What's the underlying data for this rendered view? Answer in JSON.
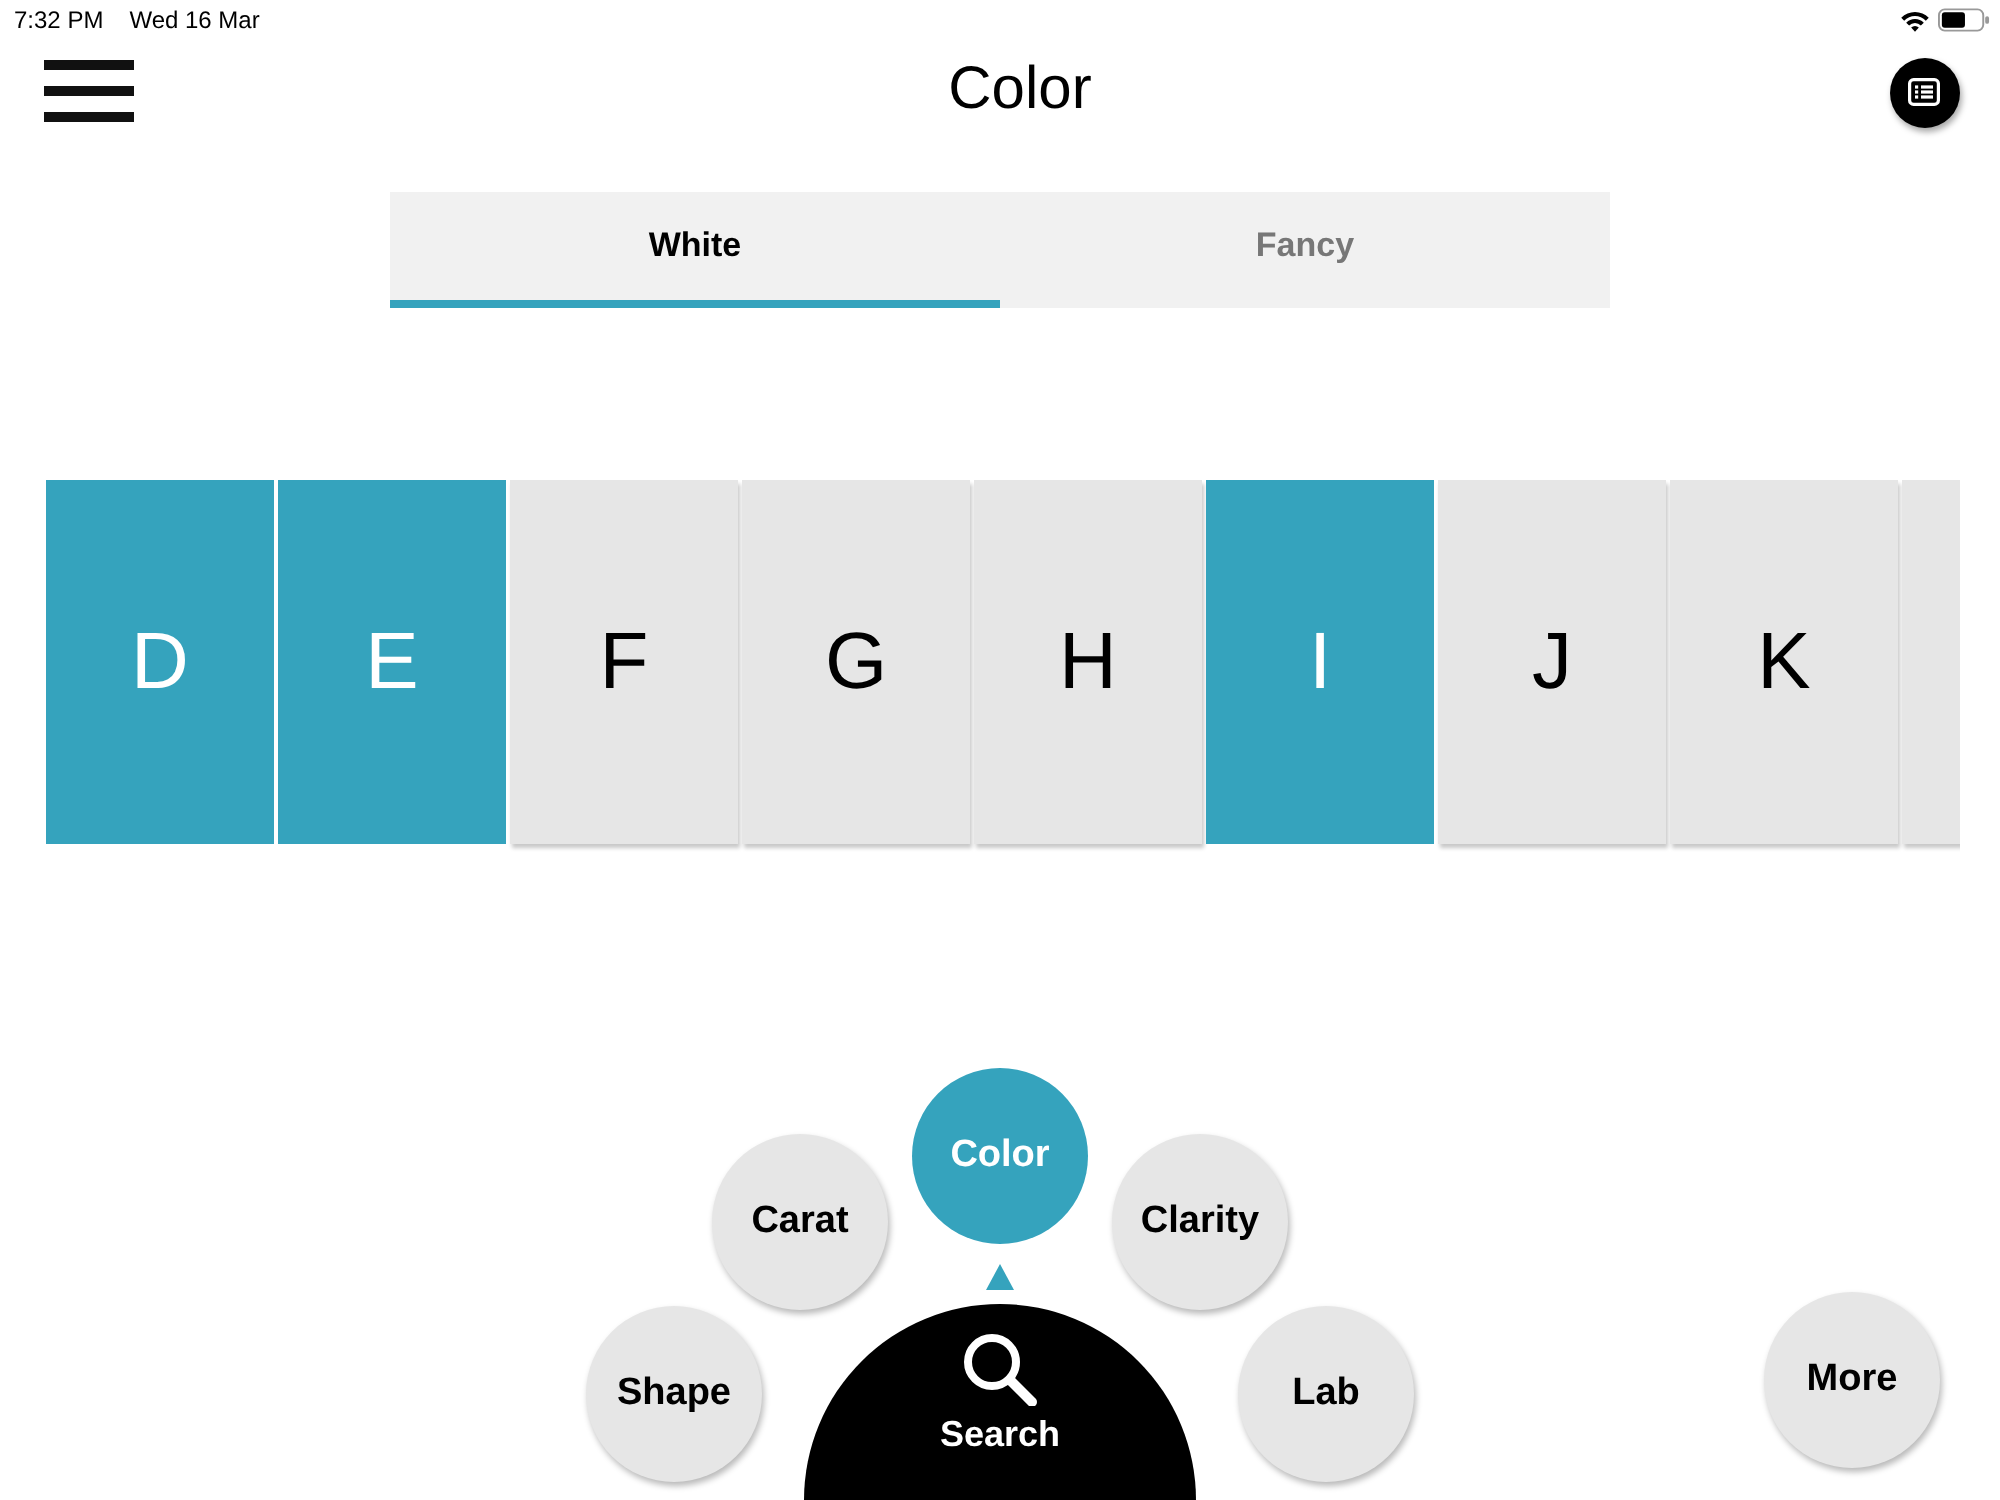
{
  "status_bar": {
    "time": "7:32 PM",
    "date": "Wed 16 Mar"
  },
  "header": {
    "title": "Color"
  },
  "tabs": [
    {
      "label": "White",
      "selected": true
    },
    {
      "label": "Fancy",
      "selected": false
    }
  ],
  "color_grades": [
    {
      "label": "D",
      "selected": true
    },
    {
      "label": "E",
      "selected": true
    },
    {
      "label": "F",
      "selected": false
    },
    {
      "label": "G",
      "selected": false
    },
    {
      "label": "H",
      "selected": false
    },
    {
      "label": "I",
      "selected": true
    },
    {
      "label": "J",
      "selected": false
    },
    {
      "label": "K",
      "selected": false
    }
  ],
  "search_menu": {
    "items": [
      {
        "label": "Shape",
        "selected": false
      },
      {
        "label": "Carat",
        "selected": false
      },
      {
        "label": "Color",
        "selected": true
      },
      {
        "label": "Clarity",
        "selected": false
      },
      {
        "label": "Lab",
        "selected": false
      }
    ],
    "search_button": {
      "label": "Search"
    }
  },
  "more_button": {
    "label": "More"
  }
}
